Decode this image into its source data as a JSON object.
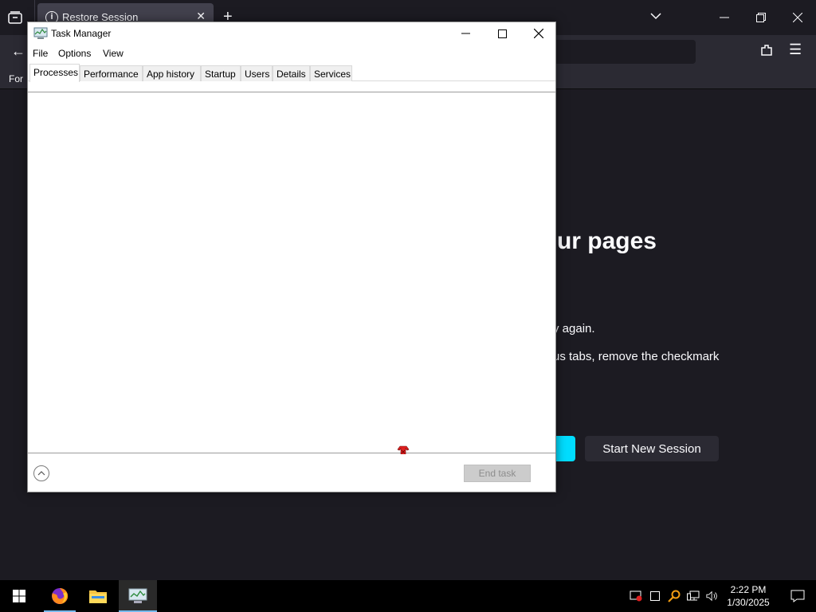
{
  "firefox": {
    "tab_title": "Restore Session",
    "bookmark_partial": "For",
    "restore_heading": "ur pages",
    "line1": "y again.",
    "line2": "us tabs, remove the checkmark",
    "start_new_session": "Start New Session",
    "accent_color": "#00ddff"
  },
  "task_manager": {
    "title": "Task Manager",
    "menu": [
      "File",
      "Options",
      "View"
    ],
    "tabs": [
      "Processes",
      "Performance",
      "App history",
      "Startup",
      "Users",
      "Details",
      "Services"
    ],
    "active_tab": "Processes",
    "end_task": "End task"
  },
  "taskbar": {
    "apps": [
      "start-icon",
      "firefox-icon",
      "file-explorer-icon",
      "task-manager-icon"
    ],
    "time": "2:22 PM",
    "date": "1/30/2025"
  }
}
